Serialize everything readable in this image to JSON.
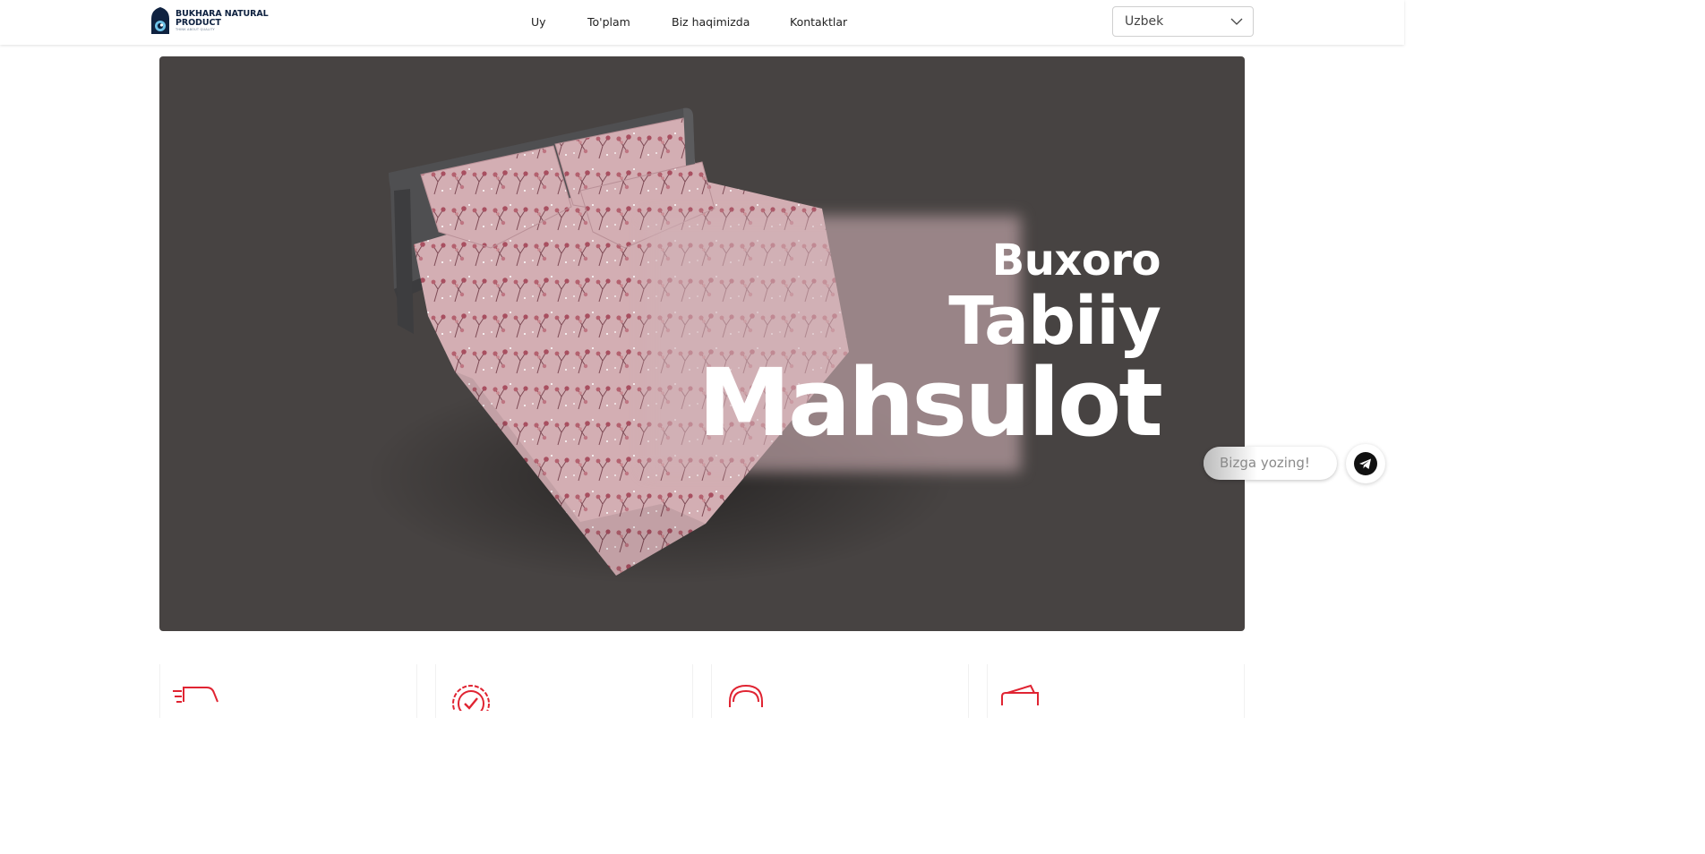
{
  "brand": {
    "line1": "BUKHARA NATURAL",
    "line2": "PRODUCT",
    "tagline": "THINK ABOUT QUALITY"
  },
  "nav": {
    "items": [
      {
        "label": "Uy"
      },
      {
        "label": "To'plam"
      },
      {
        "label": "Biz haqimizda"
      },
      {
        "label": "Kontaktlar"
      }
    ]
  },
  "language": {
    "selected": "Uzbek"
  },
  "hero": {
    "line1": "Buxoro",
    "line2": "Tabiiy",
    "line3": "Mahsulot"
  },
  "chat": {
    "prompt": "Bizga yozing!"
  },
  "features": {
    "icons": [
      "truck-icon",
      "quality-badge-icon",
      "headset-icon",
      "wallet-icon"
    ]
  },
  "colors": {
    "hero_bg": "#474342",
    "accent": "#e02432",
    "brand_navy": "#0f2240",
    "bed_fabric": "#d3aeb3"
  }
}
